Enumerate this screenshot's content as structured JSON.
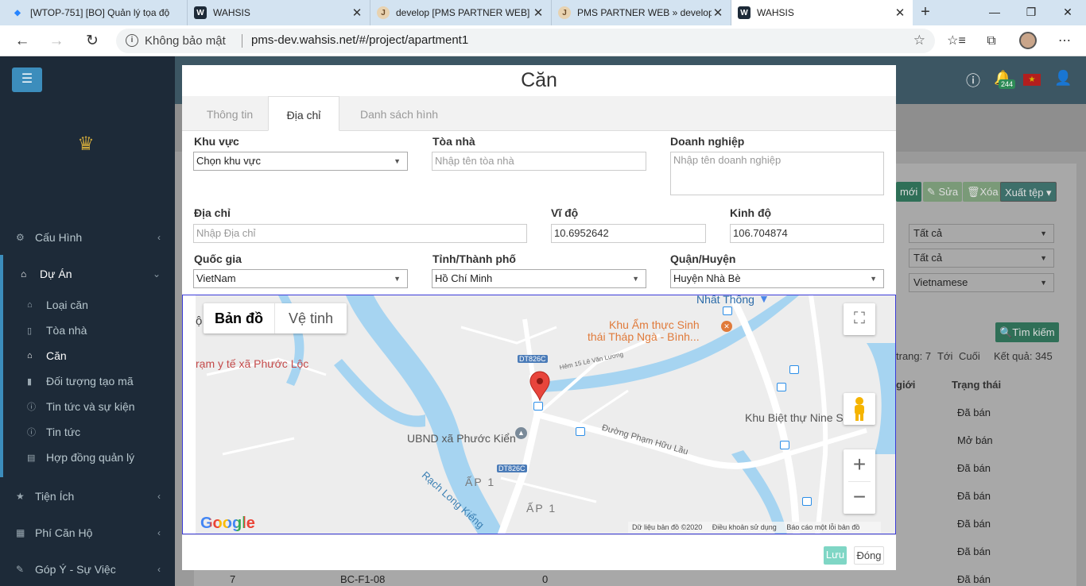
{
  "browser": {
    "tabs": [
      {
        "title": "[WTOP-751] [BO] Quản lý tọa độ",
        "icon": "jira-icon"
      },
      {
        "title": "WAHSIS",
        "icon": "wahsis-icon"
      },
      {
        "title": "develop [PMS PARTNER WEB]",
        "icon": "jenkins-icon"
      },
      {
        "title": "PMS PARTNER WEB » develop",
        "icon": "jenkins-icon"
      },
      {
        "title": "WAHSIS",
        "icon": "wahsis-icon"
      }
    ],
    "security_label": "Không bảo mật",
    "url": "pms-dev.wahsis.net/#/project/apartment1"
  },
  "sidebar": {
    "items": [
      {
        "label": "Cấu Hình"
      },
      {
        "label": "Dự Án"
      },
      {
        "label": "Tiện Ích"
      },
      {
        "label": "Phí Căn Hộ"
      },
      {
        "label": "Góp Ý - Sự Việc"
      }
    ],
    "subitems": [
      {
        "label": "Loại căn"
      },
      {
        "label": "Tòa nhà"
      },
      {
        "label": "Căn"
      },
      {
        "label": "Đối tượng tạo mã"
      },
      {
        "label": "Tin tức và sự kiện"
      },
      {
        "label": "Tin tức"
      },
      {
        "label": "Hợp đồng quản lý"
      }
    ]
  },
  "header": {
    "notification_count": "244"
  },
  "background": {
    "buttons": {
      "new": "mới",
      "edit": "Sửa",
      "delete": "Xóa",
      "export": "Xuất tệp",
      "search": "Tìm kiếm"
    },
    "filters": [
      "Tất cả",
      "Tất cả",
      "Vietnamese"
    ],
    "pagination": "trang: 7",
    "next": "Tới",
    "last": "Cuối",
    "result": "Kết quả: 345",
    "col_gender": "giới",
    "col_status": "Trạng thái",
    "statuses": [
      "Đã bán",
      "Mở bán",
      "Đã bán",
      "Đã bán",
      "Đã bán",
      "Đã bán",
      "Đã bán"
    ],
    "last_row": {
      "index": "7",
      "code": "BC-F1-08",
      "value": "0"
    }
  },
  "modal": {
    "title": "Căn",
    "tabs": [
      "Thông tin",
      "Địa chỉ",
      "Danh sách hình"
    ],
    "fields": {
      "area": {
        "label": "Khu vực",
        "value": "Chọn khu vực"
      },
      "building": {
        "label": "Tòa nhà",
        "placeholder": "Nhập tên tòa nhà"
      },
      "company": {
        "label": "Doanh nghiệp",
        "placeholder": "Nhập tên doanh nghiệp"
      },
      "address": {
        "label": "Địa chỉ",
        "placeholder": "Nhập Địa chỉ"
      },
      "latitude": {
        "label": "Vĩ độ",
        "value": "10.6952642"
      },
      "longitude": {
        "label": "Kinh độ",
        "value": "106.704874"
      },
      "country": {
        "label": "Quốc gia",
        "value": "VietNam"
      },
      "province": {
        "label": "Tỉnh/Thành phố",
        "value": "Hồ Chí Minh"
      },
      "district": {
        "label": "Quận/Huyện",
        "value": "Huyện Nhà Bè"
      }
    },
    "map": {
      "type_map": "Bản đồ",
      "type_satellite": "Vệ tinh",
      "labels": {
        "nhat_thong": "Nhất Thống",
        "restaurant_1": "Khu Ẩm thực Sinh",
        "restaurant_2": "thái Tháp Ngà - Bình...",
        "medical": "rạm y tế xã Phước Lộc",
        "ubnd": "UBND xã Phước Kiển",
        "villa": "Khu Biệt thự Nine So",
        "road": "Đường Phạm Hữu Lầu",
        "ap1a": "ẤP 1",
        "ap1b": "ẤP 1",
        "canal": "Rạch Long Kiểng",
        "lane": "Hẻm 15 Lê Văn Lương",
        "dt1": "DT826C",
        "dt2": "DT826C",
        "o_char": "ộ"
      },
      "logo": "Google",
      "attribution": "Dữ liệu bản đồ ©2020",
      "terms": "Điều khoản sử dụng",
      "report": "Báo cáo một lỗi bản đồ"
    },
    "buttons": {
      "save": "Lưu",
      "close": "Đóng"
    }
  }
}
